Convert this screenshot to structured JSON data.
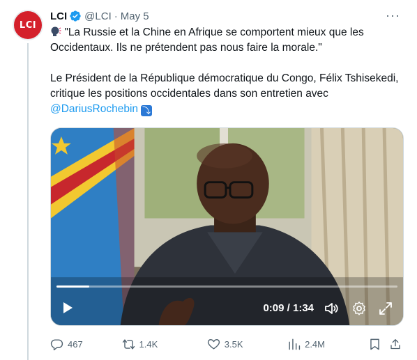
{
  "tweet": {
    "author_name": "LCI",
    "handle": "@LCI",
    "separator": "·",
    "date": "May 5",
    "avatar_text": "LCI",
    "text_line1": "\"La Russie et la Chine en Afrique se comportent mieux que les Occidentaux. Ils ne prétendent pas nous faire la morale.\"",
    "text_body": "Le Président de la République démocratique du Congo, Félix Tshisekedi, critique les positions occidentales dans son entretien avec ",
    "mention": "@DariusRochebin",
    "emoji_icon": "down-right-arrow-emoji",
    "speaking_icon": "speaking-head-emoji"
  },
  "video": {
    "time_display": "0:09 / 1:34",
    "progress_fraction": 0.096,
    "icons": [
      "play-icon",
      "volume-icon",
      "settings-icon",
      "fullscreen-icon"
    ]
  },
  "actions": {
    "replies": "467",
    "reposts": "1.4K",
    "likes": "3.5K",
    "views": "2.4M"
  },
  "colors": {
    "accent": "#1d9bf0",
    "secondary_text": "#536471",
    "brand_red": "#d4202b"
  }
}
